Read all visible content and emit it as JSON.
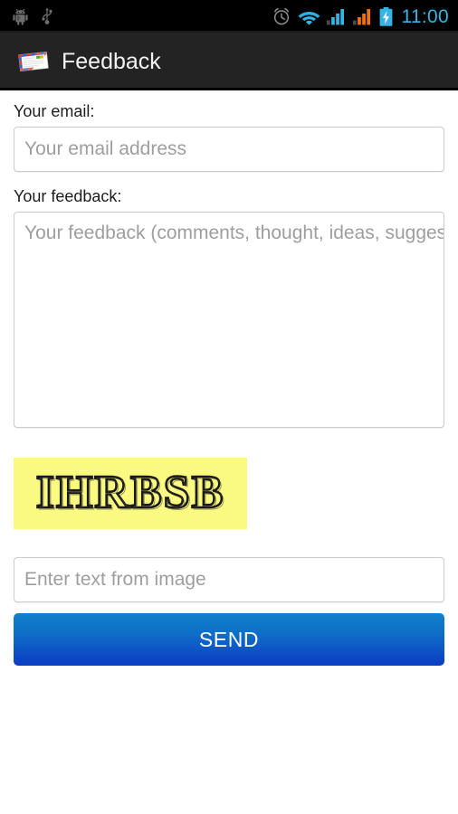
{
  "status_bar": {
    "icons_left": [
      "android-robot-icon",
      "usb-icon"
    ],
    "icons_right": [
      "alarm-clock-icon",
      "wifi-icon",
      "signal-bars-blue-icon",
      "signal-bars-orange-icon",
      "battery-charging-icon"
    ],
    "time": "11:00",
    "time_color": "#33b5e5",
    "background_color": "#000000"
  },
  "action_bar": {
    "icon": "mail-envelope-icon",
    "title": "Feedback",
    "background_color": "#232323",
    "title_color": "#f2f2f2"
  },
  "form": {
    "email": {
      "label": "Your email:",
      "placeholder": "Your email address",
      "value": ""
    },
    "feedback": {
      "label": "Your feedback:",
      "placeholder": "Your feedback (comments, thought, ideas, suggestions)",
      "value": ""
    },
    "captcha": {
      "image_text": "IHRBSB",
      "image_background_color": "#fafa82",
      "image_text_color": "#1a1a1a",
      "input_placeholder": "Enter text from image",
      "input_value": ""
    },
    "submit": {
      "label": "SEND",
      "gradient_top_color": "#1180cb",
      "gradient_bottom_color": "#0d3cc4",
      "text_color": "#ffffff"
    }
  }
}
